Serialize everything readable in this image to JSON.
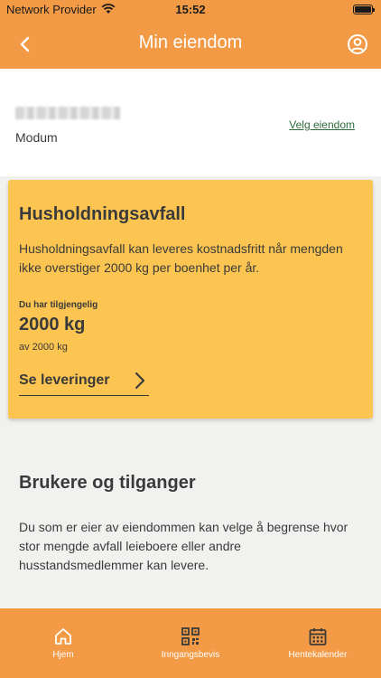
{
  "status_bar": {
    "carrier": "Network Provider",
    "time": "15:52"
  },
  "header": {
    "title": "Min eiendom",
    "back_icon": "chevron-left-icon",
    "profile_icon": "user-circle-icon"
  },
  "property": {
    "municipality": "Modum",
    "choose_label": "Velg eiendom"
  },
  "household": {
    "title": "Husholdningsavfall",
    "description": "Husholdningsavfall kan leveres kostnadsfritt når mengden ikke overstiger 2000 kg per boenhet per år.",
    "available_label": "Du har tilgjengelig",
    "available_amount": "2000 kg",
    "available_total": "av 2000 kg",
    "deliveries_label": "Se leveringer"
  },
  "access": {
    "title": "Brukere og tilganger",
    "description": "Du som er eier av eiendommen kan velge å begrense hvor stor mengde avfall leieboere eller andre husstandsmedlemmer kan levere."
  },
  "tabs": [
    {
      "label": "Hjem",
      "icon": "home-icon"
    },
    {
      "label": "Inngangsbevis",
      "icon": "qr-code-icon"
    },
    {
      "label": "Hentekalender",
      "icon": "calendar-icon"
    }
  ],
  "colors": {
    "brand_orange": "#f29a45",
    "card_yellow": "#fcc552",
    "link_green": "#2e6b3a",
    "text_dark": "#3a3a3a"
  }
}
